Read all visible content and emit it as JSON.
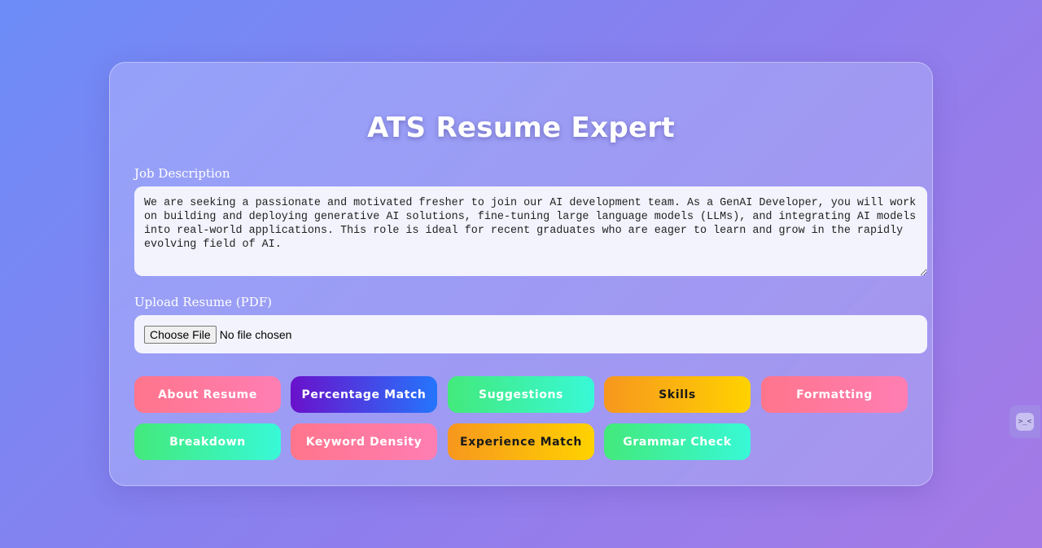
{
  "app": {
    "title": "ATS Resume Expert"
  },
  "job_description": {
    "label": "Job Description",
    "value": "We are seeking a passionate and motivated fresher to join our AI development team. As a GenAI Developer, you will work on building and deploying generative AI solutions, fine-tuning large language models (LLMs), and integrating AI models into real-world applications. This role is ideal for recent graduates who are eager to learn and grow in the rapidly evolving field of AI."
  },
  "upload": {
    "label": "Upload Resume (PDF)",
    "button_label": "Choose File",
    "status_text": "No file chosen"
  },
  "actions": {
    "row1": [
      {
        "label": "About Resume",
        "style": "pink"
      },
      {
        "label": "Percentage Match",
        "style": "purple"
      },
      {
        "label": "Suggestions",
        "style": "green"
      },
      {
        "label": "Skills",
        "style": "orange"
      },
      {
        "label": "Formatting",
        "style": "pink"
      }
    ],
    "row2": [
      {
        "label": "Breakdown",
        "style": "green"
      },
      {
        "label": "Keyword Density",
        "style": "pink"
      },
      {
        "label": "Experience Match",
        "style": "orange"
      },
      {
        "label": "Grammar Check",
        "style": "green"
      }
    ]
  },
  "side_widget": {
    "icon": "assistant-face-icon",
    "glyph": ">_<"
  },
  "colors": {
    "pink": "#ff758c",
    "purple": "#6a11cb",
    "blue": "#2575fc",
    "green": "#43e97b",
    "teal": "#38f9d7",
    "orange": "#f7971e",
    "yellow": "#ffd200"
  }
}
